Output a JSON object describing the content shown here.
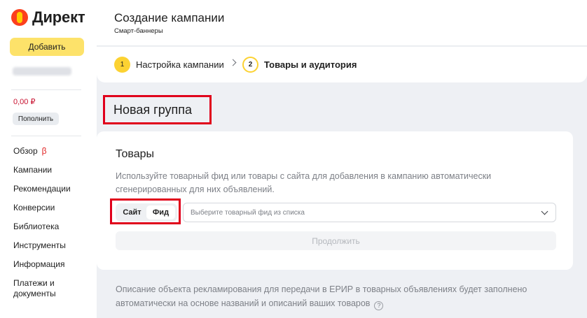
{
  "sidebar": {
    "logo_text": "Директ",
    "add_button": "Добавить",
    "balance": "0,00 ₽",
    "topup_button": "Пополнить",
    "nav": [
      {
        "label": "Обзор",
        "badge": "β"
      },
      {
        "label": "Кампании"
      },
      {
        "label": "Рекомендации"
      },
      {
        "label": "Конверсии"
      },
      {
        "label": "Библиотека"
      },
      {
        "label": "Инструменты"
      },
      {
        "label": "Информация"
      },
      {
        "label": "Платежи и документы"
      }
    ]
  },
  "header": {
    "title": "Создание кампании",
    "subtitle": "Смарт-баннеры"
  },
  "stepper": {
    "steps": [
      {
        "number": "1",
        "label": "Настройка кампании"
      },
      {
        "number": "2",
        "label": "Товары и аудитория"
      }
    ]
  },
  "group": {
    "title": "Новая группа"
  },
  "products": {
    "title": "Товары",
    "description": "Используйте товарный фид или товары с сайта для добавления в кампанию автоматически сгенерированных для них объявлений.",
    "source_options": [
      "Сайт",
      "Фид"
    ],
    "selected_source": "Фид",
    "feed_placeholder": "Выберите товарный фид из списка",
    "continue_button": "Продолжить"
  },
  "note": {
    "text": "Описание объекта рекламирования для передачи в ЕРИР в товарных объявлениях будет заполнено автоматически на основе названий и описаний ваших товаров",
    "help_glyph": "?"
  },
  "colors": {
    "brand_yellow": "#fde26a",
    "highlight_red": "#e0001b",
    "balance_red": "#c8102e"
  }
}
